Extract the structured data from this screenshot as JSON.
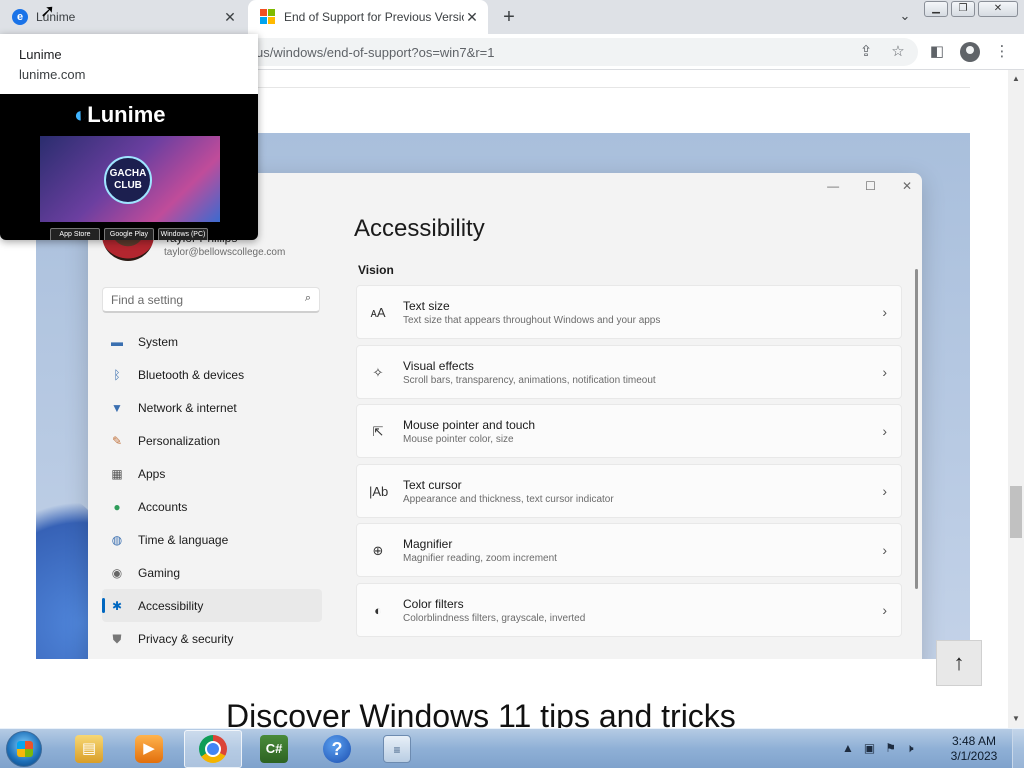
{
  "browser": {
    "tabs": [
      {
        "title": "Lunime",
        "favicon": "lunime-logo-icon",
        "active": false
      },
      {
        "title": "End of Support for Previous Versions of Windows",
        "favicon": "microsoft-logo-icon",
        "active": true
      }
    ],
    "new_tab": "+",
    "tab_search": "⌄",
    "url": "us/windows/end-of-support?os=win7&r=1"
  },
  "hovercard": {
    "title": "Lunime",
    "domain": "lunime.com",
    "logo_text": "Lunime",
    "art_text": "GACHA CLUB",
    "stores": [
      "App Store",
      "Google Play",
      "Windows (PC)"
    ]
  },
  "settings_window": {
    "user_name": "Taylor Phillips",
    "user_email": "taylor@bellowscollege.com",
    "search_placeholder": "Find a setting",
    "nav": [
      {
        "label": "System",
        "icon": "monitor-icon"
      },
      {
        "label": "Bluetooth & devices",
        "icon": "bluetooth-icon"
      },
      {
        "label": "Network & internet",
        "icon": "wifi-icon"
      },
      {
        "label": "Personalization",
        "icon": "brush-icon"
      },
      {
        "label": "Apps",
        "icon": "apps-icon"
      },
      {
        "label": "Accounts",
        "icon": "account-icon"
      },
      {
        "label": "Time & language",
        "icon": "globe-icon"
      },
      {
        "label": "Gaming",
        "icon": "gamepad-icon"
      },
      {
        "label": "Accessibility",
        "icon": "accessibility-icon",
        "active": true
      },
      {
        "label": "Privacy & security",
        "icon": "shield-icon"
      }
    ],
    "title": "Accessibility",
    "section": "Vision",
    "cards": [
      {
        "title": "Text size",
        "subtitle": "Text size that appears throughout Windows and your apps",
        "icon": "text-size-icon"
      },
      {
        "title": "Visual effects",
        "subtitle": "Scroll bars, transparency, animations, notification timeout",
        "icon": "sparkle-icon"
      },
      {
        "title": "Mouse pointer and touch",
        "subtitle": "Mouse pointer color, size",
        "icon": "pointer-icon"
      },
      {
        "title": "Text cursor",
        "subtitle": "Appearance and thickness, text cursor indicator",
        "icon": "text-cursor-icon"
      },
      {
        "title": "Magnifier",
        "subtitle": "Magnifier reading, zoom increment",
        "icon": "magnifier-icon"
      },
      {
        "title": "Color filters",
        "subtitle": "Colorblindness filters, grayscale, inverted",
        "icon": "color-filter-icon"
      }
    ]
  },
  "page": {
    "heading": "Discover Windows 11 tips and tricks"
  },
  "taskbar": {
    "apps": [
      "windows-explorer",
      "media-center",
      "google-chrome",
      "csharp-editor",
      "help-and-support",
      "file-document"
    ],
    "clock_time": "3:48 AM",
    "clock_date": "3/1/2023"
  }
}
